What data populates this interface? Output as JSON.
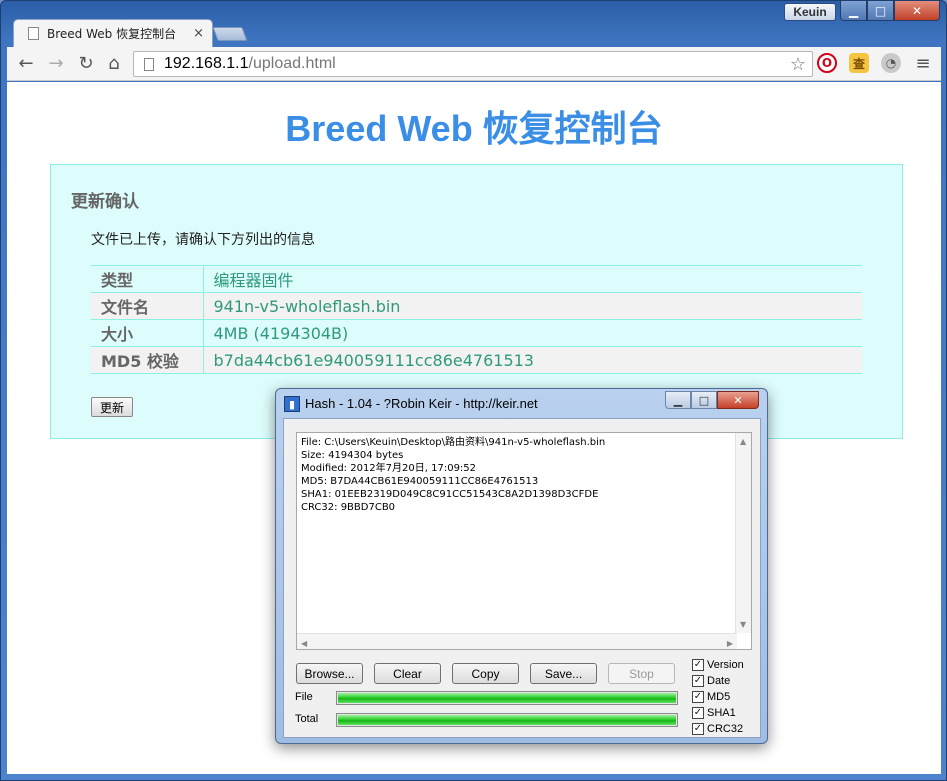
{
  "browser": {
    "profile_label": "Keuin",
    "tab_title": "Breed Web 恢复控制台",
    "tab_close": "×",
    "url_host": "192.168.1.1",
    "url_path": "/upload.html",
    "ext_opera_glyph": "O",
    "ext_dict_glyph": "查"
  },
  "page": {
    "title": "Breed Web 恢复控制台",
    "panel_title": "更新确认",
    "description": "文件已上传，请确认下方列出的信息",
    "rows": [
      {
        "key": "类型",
        "value": "编程器固件"
      },
      {
        "key": "文件名",
        "value": "941n-v5-wholeflash.bin"
      },
      {
        "key": "大小",
        "value": "4MB (4194304B)"
      },
      {
        "key": "MD5 校验",
        "value": "b7da44cb61e940059111cc86e4761513"
      }
    ],
    "update_button": "更新"
  },
  "hash_dialog": {
    "title": "Hash - 1.04 - ?Robin Keir - http://keir.net",
    "output_lines": [
      "File: C:\\Users\\Keuin\\Desktop\\路由资料\\941n-v5-wholeflash.bin",
      "Size: 4194304 bytes",
      "Modified: 2012年7月20日, 17:09:52",
      "MD5: B7DA44CB61E940059111CC86E4761513",
      "SHA1: 01EEB2319D049C8C91CC51543C8A2D1398D3CFDE",
      "CRC32: 9BBD7CB0"
    ],
    "buttons": {
      "browse": "Browse...",
      "clear": "Clear",
      "copy": "Copy",
      "save": "Save...",
      "stop": "Stop"
    },
    "progress": {
      "file_label": "File",
      "file_value": 1.0,
      "total_label": "Total",
      "total_value": 1.0
    },
    "options": [
      {
        "label": "Version",
        "checked": true
      },
      {
        "label": "Date",
        "checked": true
      },
      {
        "label": "MD5",
        "checked": true
      },
      {
        "label": "SHA1",
        "checked": true
      },
      {
        "label": "CRC32",
        "checked": true
      }
    ]
  },
  "colors": {
    "title_blue": "#3a8ee6",
    "panel_bg": "#ddfdfc",
    "value_green": "#2e9a7c"
  }
}
